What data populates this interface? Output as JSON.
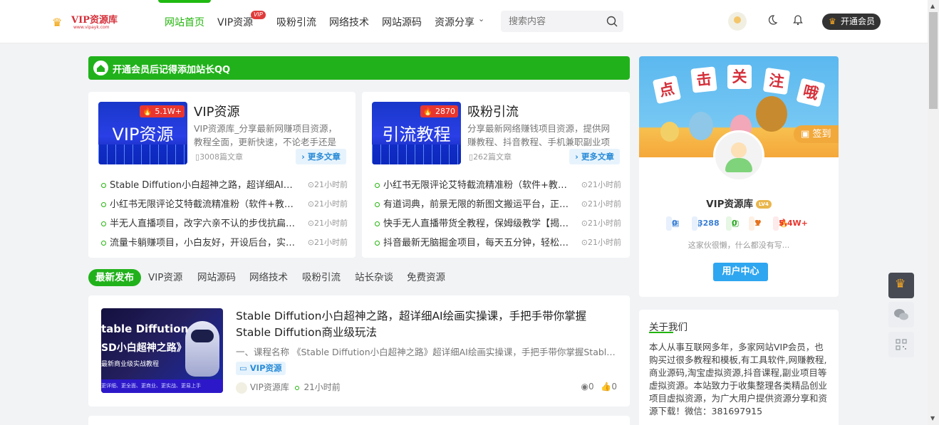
{
  "header": {
    "logo_text": "VIP资源库",
    "logo_sub": "www.vipayk.com",
    "nav": [
      {
        "label": "网站首页"
      },
      {
        "label": "VIP资源",
        "badge": "VIP"
      },
      {
        "label": "吸粉引流"
      },
      {
        "label": "网络技术"
      },
      {
        "label": "网站源码"
      },
      {
        "label": "资源分享"
      }
    ],
    "search_placeholder": "搜索内容",
    "open_vip_label": "开通会员"
  },
  "notice": {
    "text": "开通会员后记得添加站长QQ"
  },
  "categories": [
    {
      "title": "VIP资源",
      "thumb_text": "VIP资源",
      "hot": "5.1W+",
      "desc": "VIP资源库_分享最新网赚项目资源，教程全面，更新快速，不论老手还是新手都可以学习",
      "count": "3008篇文章",
      "more": "更多文章",
      "items": [
        {
          "title": "Stable Diffution小白超神之路，超详细AI绘画实操课",
          "time": "21小时前"
        },
        {
          "title": "小红书无限评论艾特截流精准粉（软件+教程）",
          "time": "21小时前"
        },
        {
          "title": "半无人直播项目，改字六亲不认的步伐抗扁担项目",
          "time": "21小时前"
        },
        {
          "title": "流量卡躺赚项目，小白友好，开设后台，实操教学",
          "time": "21小时前"
        }
      ]
    },
    {
      "title": "吸粉引流",
      "thumb_text": "引流教程",
      "hot": "2870",
      "desc": "分享最新网络赚钱项目资源，提供网赚教程、抖音教程、手机兼职副业项目",
      "count": "262篇文章",
      "more": "更多文章",
      "items": [
        {
          "title": "小红书无限评论艾特截流精准粉（软件+教程）",
          "time": "21小时前"
        },
        {
          "title": "有道词典，前景无限的新图文搬运平台，正规项目",
          "time": "21小时前"
        },
        {
          "title": "快手无人直播带货全教程，保姆级教学【揭秘】",
          "time": "21小时前"
        },
        {
          "title": "抖音最新无脑掘金项目，每天五分钟，轻松月入",
          "time": "21小时前"
        }
      ]
    }
  ],
  "tabs": [
    "最新发布",
    "VIP资源",
    "网站源码",
    "网络技术",
    "吸粉引流",
    "站长杂谈",
    "免费资源"
  ],
  "post": {
    "image_line1": "table Diffution",
    "image_line2": "SD小白超神之路》",
    "image_line3": "最新商业级实战教程",
    "image_bar": "更详细、更全面、更商业、更实战、更易上手",
    "title": "Stable Diffution小白超神之路，超详细AI绘画实操课，手把手带你掌握Stable Diffution商业级玩法",
    "desc": "一、课程名称 《Stable Diffution小白超神之路》超详细AI绘画实操课，手把手带你掌握Stable Diffution商业级玩法",
    "tag": "VIP资源",
    "author": "VIP资源库",
    "time": "21小时前",
    "views": "0",
    "likes": "0"
  },
  "sidebar": {
    "banner_chars": [
      "点",
      "击",
      "关",
      "注",
      "哦"
    ],
    "signin_label": "签到",
    "username": "VIP资源库",
    "level": "LV4",
    "stats": {
      "s1": "0",
      "s2": "3288",
      "s3": "0",
      "s4": "1",
      "s5": "5.4W+"
    },
    "signature": "这家伙很懒，什么都没有写...",
    "user_center_label": "用户中心",
    "about_title": "关于我们",
    "about_text": "本人从事互联网多年，多家网站VIP会员，也购买过很多教程和模板,有工具软件,网赚教程,商业源码,淘宝虚拟资源,抖音课程,副业项目等虚拟资源。本站致力于收集整理各类精品创业项目虚拟资源，为广大用户提供资源分享和资源下载！微信：381697915"
  },
  "colors": {
    "accent": "#21b21b",
    "link": "#2a8cd8",
    "hot": "#e8362f"
  }
}
